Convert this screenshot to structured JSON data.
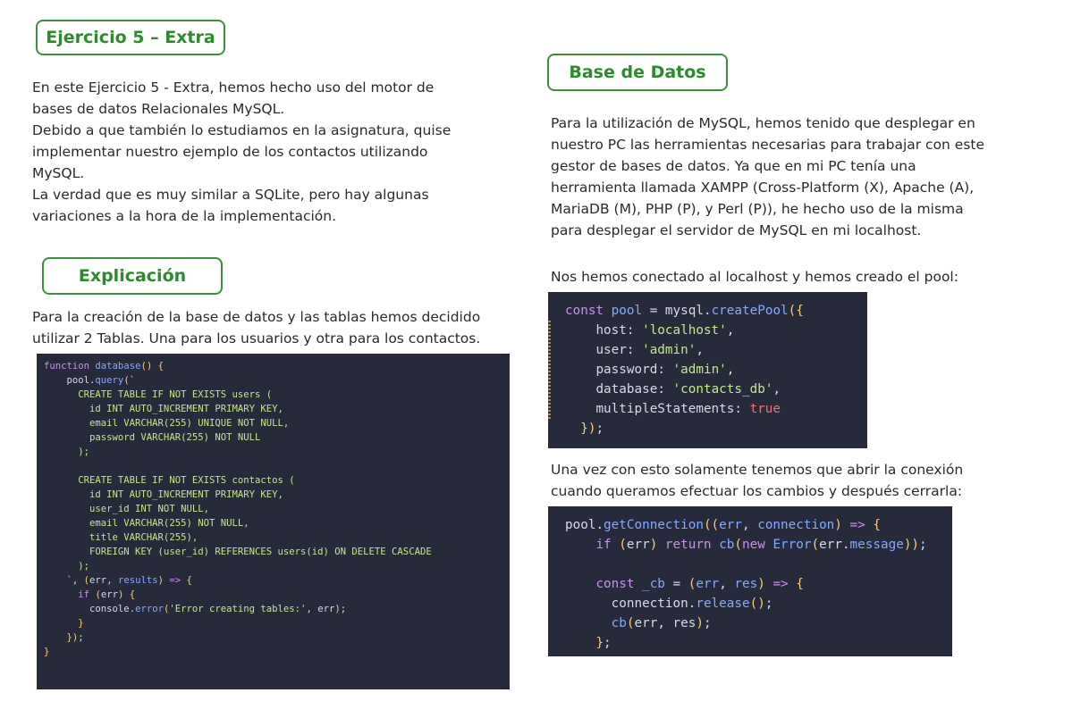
{
  "left": {
    "heading_ejercicio": "Ejercicio 5 – Extra",
    "intro_lines": [
      "En este Ejercicio 5 - Extra, hemos hecho uso del motor de",
      "bases de datos Relacionales MySQL.",
      "Debido a que también lo estudiamos en la asignatura, quise",
      "implementar nuestro ejemplo de los contactos utilizando",
      "MySQL.",
      "La verdad que es muy similar a SQLite, pero hay algunas",
      "variaciones a la hora de la implementación."
    ],
    "heading_explicacion": "Explicación",
    "explicacion_lines": [
      "Para la creación de la base de datos y las tablas hemos decidido",
      "utilizar 2 Tablas. Una para los usuarios y otra para los contactos."
    ],
    "code_database_lines": [
      "function database() {",
      "    pool.query(`",
      "      CREATE TABLE IF NOT EXISTS users (",
      "        id INT AUTO_INCREMENT PRIMARY KEY,",
      "        email VARCHAR(255) UNIQUE NOT NULL,",
      "        password VARCHAR(255) NOT NULL",
      "      );",
      "",
      "      CREATE TABLE IF NOT EXISTS contactos (",
      "        id INT AUTO_INCREMENT PRIMARY KEY,",
      "        user_id INT NOT NULL,",
      "        email VARCHAR(255) NOT NULL,",
      "        title VARCHAR(255),",
      "        FOREIGN KEY (user_id) REFERENCES users(id) ON DELETE CASCADE",
      "      );",
      "    `, (err, results) => {",
      "      if (err) {",
      "        console.error('Error creating tables:', err);",
      "      }",
      "    });",
      "}"
    ]
  },
  "right": {
    "heading_base": "Base de Datos",
    "base_lines": [
      "Para la utilización de MySQL, hemos tenido que desplegar en",
      "nuestro PC las herramientas necesarias para trabajar con este",
      "gestor de bases de datos. Ya que en mi PC tenía una",
      "herramienta llamada XAMPP (Cross-Platform (X), Apache (A),",
      "MariaDB (M), PHP (P), y Perl (P)), he hecho uso de la misma",
      "para desplegar el servidor de MySQL en mi localhost."
    ],
    "pool_text": "Nos hemos conectado al localhost y hemos creado el pool:",
    "code_pool_lines": [
      "const pool = mysql.createPool({",
      "    host: 'localhost',",
      "    user: 'admin',",
      "    password: 'admin',",
      "    database: 'contacts_db',",
      "    multipleStatements: true",
      "  });"
    ],
    "conexion_lines": [
      "Una vez con esto solamente tenemos que abrir la conexión",
      "cuando queramos efectuar los cambios y después cerrarla:"
    ],
    "code_conn_lines": [
      "pool.getConnection((err, connection) => {",
      "    if (err) return cb(new Error(err.message));",
      "",
      "    const _cb = (err, res) => {",
      "      connection.release();",
      "      cb(err, res);",
      "    };",
      "    // "
    ]
  },
  "colors": {
    "accent_green": "#2f8a2f",
    "code_background": "#262a3b"
  }
}
